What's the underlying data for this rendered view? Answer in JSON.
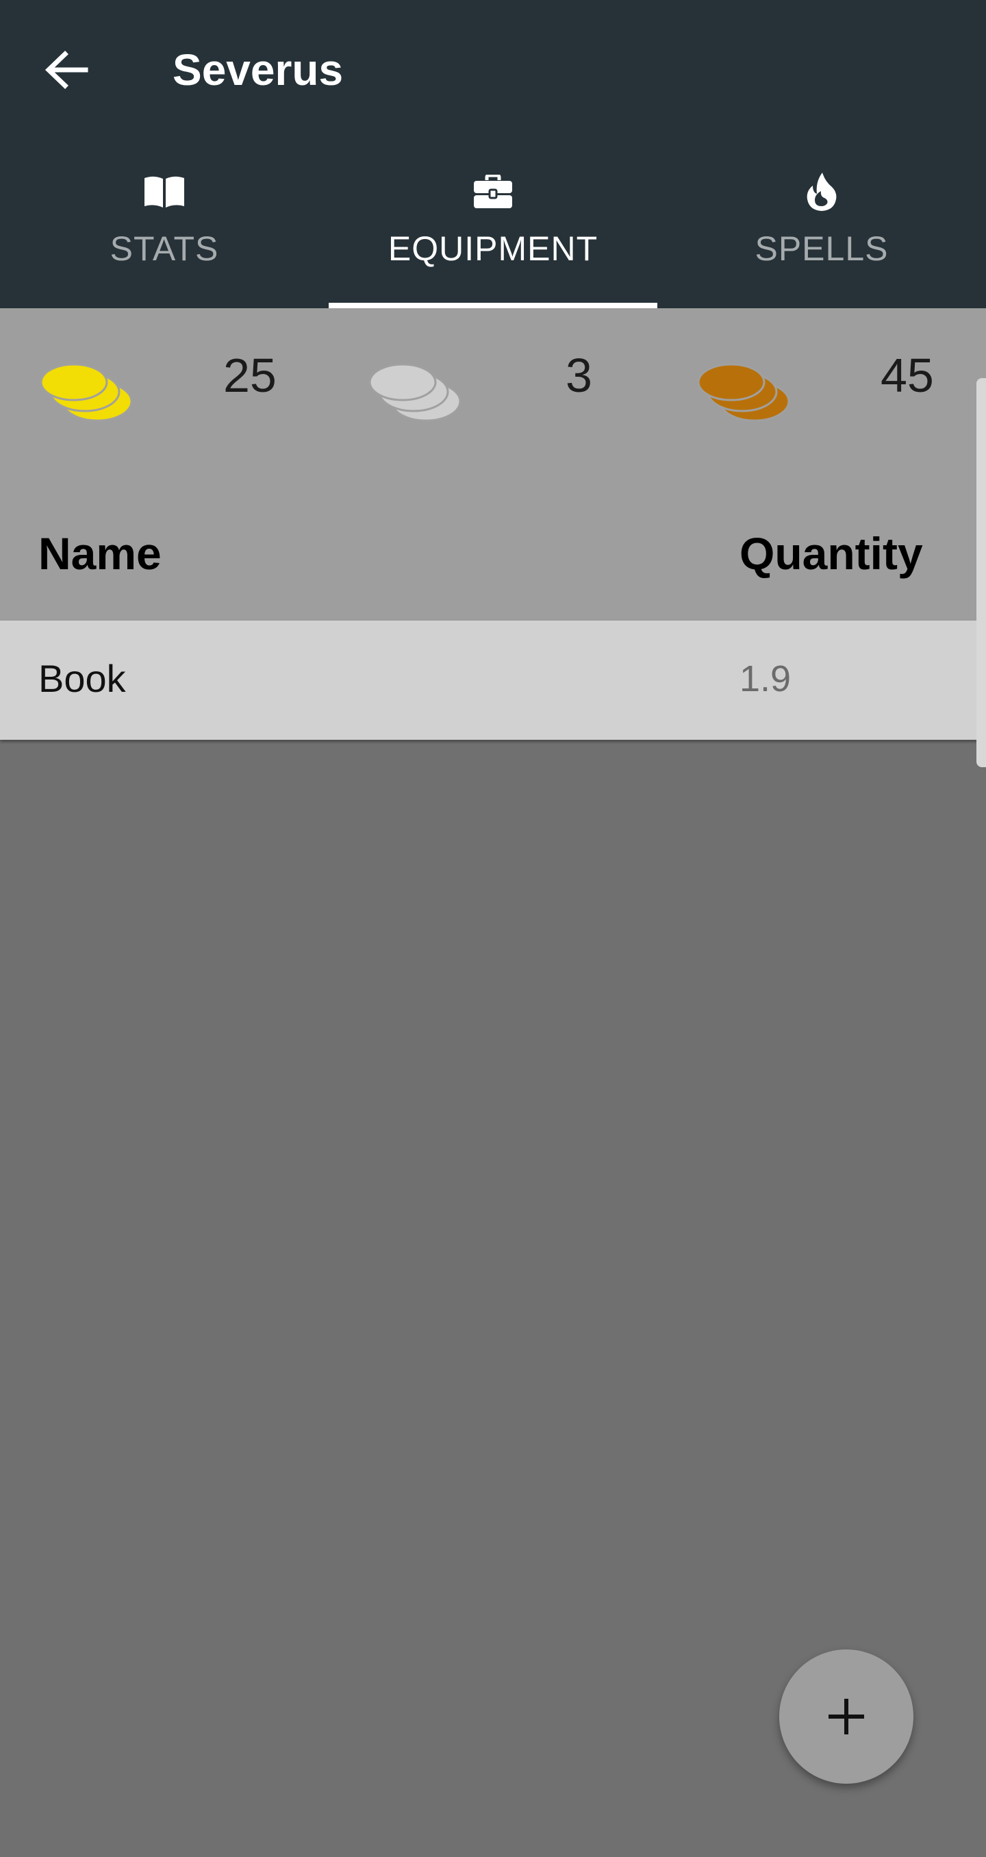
{
  "app_bar": {
    "title": "Severus",
    "back_icon": "arrow-left-icon"
  },
  "tabs": [
    {
      "label": "STATS",
      "icon": "book-open-icon",
      "active": false
    },
    {
      "label": "EQUIPMENT",
      "icon": "briefcase-icon",
      "active": true
    },
    {
      "label": "SPELLS",
      "icon": "fire-icon",
      "active": false
    }
  ],
  "coins": [
    {
      "name": "gold-coins-icon",
      "color": "#f2dd05",
      "value": "25"
    },
    {
      "name": "silver-coins-icon",
      "color": "#cfcfcf",
      "value": "3"
    },
    {
      "name": "copper-coins-icon",
      "color": "#b8710a",
      "value": "45"
    }
  ],
  "table": {
    "headers": {
      "name": "Name",
      "quantity": "Quantity"
    },
    "rows": [
      {
        "name": "Book",
        "quantity": "1.9"
      }
    ]
  },
  "fab": {
    "icon": "plus-icon"
  },
  "colors": {
    "app_bar": "#263238",
    "content_background": "#9e9e9e",
    "empty_background": "#707070",
    "row_background": "#d1d1d1",
    "tab_active": "#ffffff",
    "tab_inactive": "#a6abae"
  }
}
